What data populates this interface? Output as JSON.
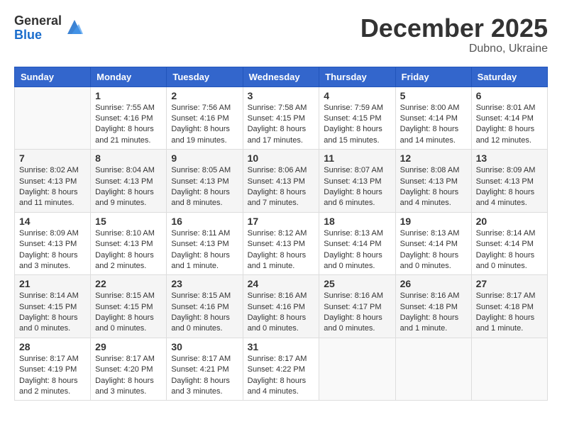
{
  "logo": {
    "general": "General",
    "blue": "Blue"
  },
  "header": {
    "month": "December 2025",
    "location": "Dubno, Ukraine"
  },
  "days_of_week": [
    "Sunday",
    "Monday",
    "Tuesday",
    "Wednesday",
    "Thursday",
    "Friday",
    "Saturday"
  ],
  "weeks": [
    [
      {
        "day": "",
        "info": ""
      },
      {
        "day": "1",
        "info": "Sunrise: 7:55 AM\nSunset: 4:16 PM\nDaylight: 8 hours\nand 21 minutes."
      },
      {
        "day": "2",
        "info": "Sunrise: 7:56 AM\nSunset: 4:16 PM\nDaylight: 8 hours\nand 19 minutes."
      },
      {
        "day": "3",
        "info": "Sunrise: 7:58 AM\nSunset: 4:15 PM\nDaylight: 8 hours\nand 17 minutes."
      },
      {
        "day": "4",
        "info": "Sunrise: 7:59 AM\nSunset: 4:15 PM\nDaylight: 8 hours\nand 15 minutes."
      },
      {
        "day": "5",
        "info": "Sunrise: 8:00 AM\nSunset: 4:14 PM\nDaylight: 8 hours\nand 14 minutes."
      },
      {
        "day": "6",
        "info": "Sunrise: 8:01 AM\nSunset: 4:14 PM\nDaylight: 8 hours\nand 12 minutes."
      }
    ],
    [
      {
        "day": "7",
        "info": "Sunrise: 8:02 AM\nSunset: 4:13 PM\nDaylight: 8 hours\nand 11 minutes."
      },
      {
        "day": "8",
        "info": "Sunrise: 8:04 AM\nSunset: 4:13 PM\nDaylight: 8 hours\nand 9 minutes."
      },
      {
        "day": "9",
        "info": "Sunrise: 8:05 AM\nSunset: 4:13 PM\nDaylight: 8 hours\nand 8 minutes."
      },
      {
        "day": "10",
        "info": "Sunrise: 8:06 AM\nSunset: 4:13 PM\nDaylight: 8 hours\nand 7 minutes."
      },
      {
        "day": "11",
        "info": "Sunrise: 8:07 AM\nSunset: 4:13 PM\nDaylight: 8 hours\nand 6 minutes."
      },
      {
        "day": "12",
        "info": "Sunrise: 8:08 AM\nSunset: 4:13 PM\nDaylight: 8 hours\nand 4 minutes."
      },
      {
        "day": "13",
        "info": "Sunrise: 8:09 AM\nSunset: 4:13 PM\nDaylight: 8 hours\nand 4 minutes."
      }
    ],
    [
      {
        "day": "14",
        "info": "Sunrise: 8:09 AM\nSunset: 4:13 PM\nDaylight: 8 hours\nand 3 minutes."
      },
      {
        "day": "15",
        "info": "Sunrise: 8:10 AM\nSunset: 4:13 PM\nDaylight: 8 hours\nand 2 minutes."
      },
      {
        "day": "16",
        "info": "Sunrise: 8:11 AM\nSunset: 4:13 PM\nDaylight: 8 hours\nand 1 minute."
      },
      {
        "day": "17",
        "info": "Sunrise: 8:12 AM\nSunset: 4:13 PM\nDaylight: 8 hours\nand 1 minute."
      },
      {
        "day": "18",
        "info": "Sunrise: 8:13 AM\nSunset: 4:14 PM\nDaylight: 8 hours\nand 0 minutes."
      },
      {
        "day": "19",
        "info": "Sunrise: 8:13 AM\nSunset: 4:14 PM\nDaylight: 8 hours\nand 0 minutes."
      },
      {
        "day": "20",
        "info": "Sunrise: 8:14 AM\nSunset: 4:14 PM\nDaylight: 8 hours\nand 0 minutes."
      }
    ],
    [
      {
        "day": "21",
        "info": "Sunrise: 8:14 AM\nSunset: 4:15 PM\nDaylight: 8 hours\nand 0 minutes."
      },
      {
        "day": "22",
        "info": "Sunrise: 8:15 AM\nSunset: 4:15 PM\nDaylight: 8 hours\nand 0 minutes."
      },
      {
        "day": "23",
        "info": "Sunrise: 8:15 AM\nSunset: 4:16 PM\nDaylight: 8 hours\nand 0 minutes."
      },
      {
        "day": "24",
        "info": "Sunrise: 8:16 AM\nSunset: 4:16 PM\nDaylight: 8 hours\nand 0 minutes."
      },
      {
        "day": "25",
        "info": "Sunrise: 8:16 AM\nSunset: 4:17 PM\nDaylight: 8 hours\nand 0 minutes."
      },
      {
        "day": "26",
        "info": "Sunrise: 8:16 AM\nSunset: 4:18 PM\nDaylight: 8 hours\nand 1 minute."
      },
      {
        "day": "27",
        "info": "Sunrise: 8:17 AM\nSunset: 4:18 PM\nDaylight: 8 hours\nand 1 minute."
      }
    ],
    [
      {
        "day": "28",
        "info": "Sunrise: 8:17 AM\nSunset: 4:19 PM\nDaylight: 8 hours\nand 2 minutes."
      },
      {
        "day": "29",
        "info": "Sunrise: 8:17 AM\nSunset: 4:20 PM\nDaylight: 8 hours\nand 3 minutes."
      },
      {
        "day": "30",
        "info": "Sunrise: 8:17 AM\nSunset: 4:21 PM\nDaylight: 8 hours\nand 3 minutes."
      },
      {
        "day": "31",
        "info": "Sunrise: 8:17 AM\nSunset: 4:22 PM\nDaylight: 8 hours\nand 4 minutes."
      },
      {
        "day": "",
        "info": ""
      },
      {
        "day": "",
        "info": ""
      },
      {
        "day": "",
        "info": ""
      }
    ]
  ]
}
